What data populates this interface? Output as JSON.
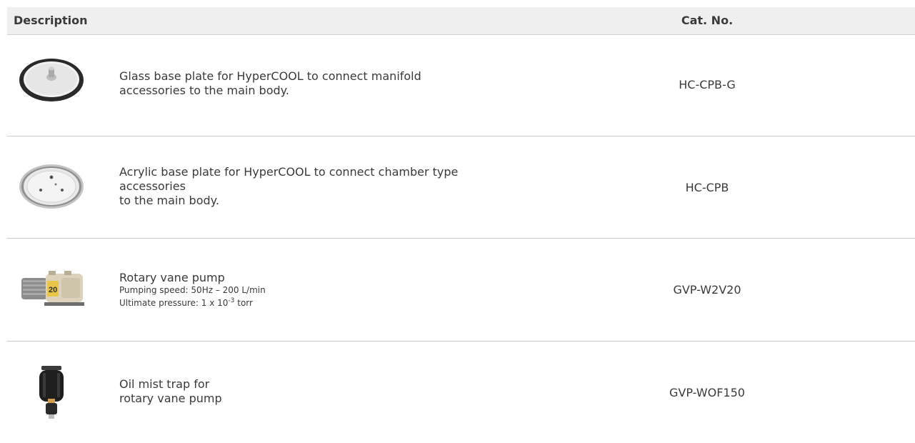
{
  "header": {
    "description": "Description",
    "cat_no": "Cat. No."
  },
  "rows": [
    {
      "lines": [
        "Glass base plate for HyperCOOL to connect manifold",
        "accessories to the main body."
      ],
      "cat_no": "HC-CPB-G",
      "image": "glass-base-plate-icon"
    },
    {
      "lines": [
        "Acrylic base plate for HyperCOOL to connect chamber type",
        "accessories",
        "to the main body."
      ],
      "cat_no": "HC-CPB",
      "image": "acrylic-base-plate-icon"
    },
    {
      "title": "Rotary vane pump",
      "specs": {
        "speed": "Pumping speed: 50Hz – 200 L/min",
        "pressure_prefix": "Ultimate pressure: 1 x 10",
        "pressure_exp": "-3",
        "pressure_unit": " torr"
      },
      "cat_no": "GVP-W2V20",
      "image": "rotary-vane-pump-icon"
    },
    {
      "lines": [
        "Oil mist trap for",
        "rotary vane pump"
      ],
      "cat_no": "GVP-WOF150",
      "image": "oil-mist-trap-icon"
    }
  ]
}
